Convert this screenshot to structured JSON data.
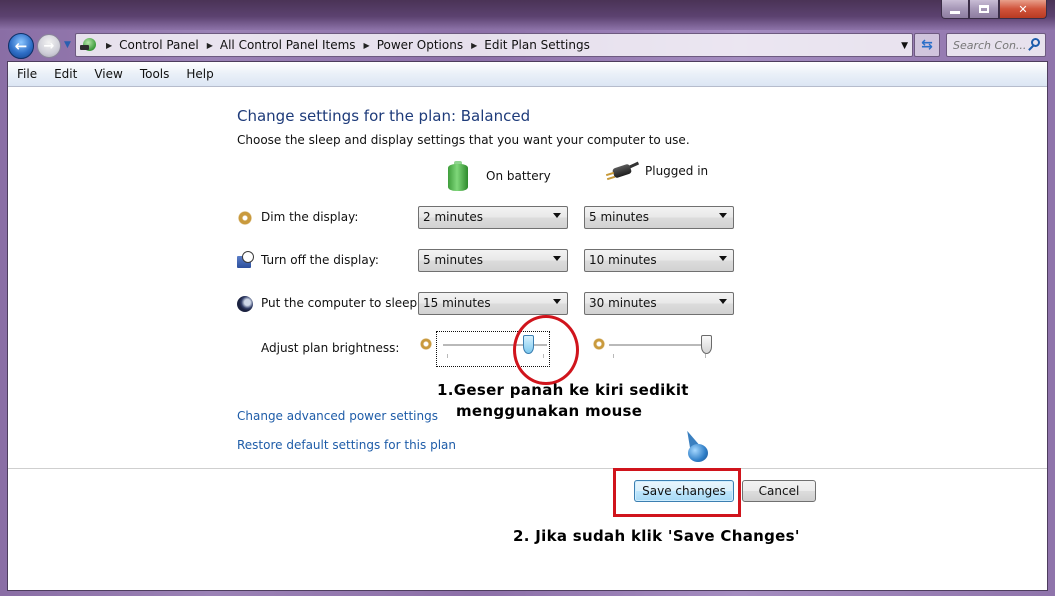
{
  "window": {
    "caption_buttons": [
      "minimize",
      "maximize",
      "close"
    ]
  },
  "nav": {
    "back_icon": "back-arrow-icon",
    "forward_icon": "forward-arrow-icon",
    "breadcrumb": [
      "Control Panel",
      "All Control Panel Items",
      "Power Options",
      "Edit Plan Settings"
    ],
    "search_placeholder": "Search Con...",
    "refresh_icon": "refresh-icon"
  },
  "menubar": {
    "items": [
      "File",
      "Edit",
      "View",
      "Tools",
      "Help"
    ]
  },
  "page": {
    "title": "Change settings for the plan: Balanced",
    "subtitle": "Choose the sleep and display settings that you want your computer to use.",
    "columns": {
      "battery": "On battery",
      "plugged": "Plugged in"
    },
    "settings": [
      {
        "label": "Dim the display:",
        "icon": "dim-display-icon",
        "battery": "2 minutes",
        "plugged": "5 minutes"
      },
      {
        "label": "Turn off the display:",
        "icon": "display-off-icon",
        "battery": "5 minutes",
        "plugged": "10 minutes"
      },
      {
        "label": "Put the computer to sleep:",
        "icon": "sleep-icon",
        "battery": "15 minutes",
        "plugged": "30 minutes"
      }
    ],
    "brightness": {
      "label": "Adjust plan brightness:",
      "battery_level_percent": 85,
      "plugged_level_percent": 100
    },
    "links": {
      "advanced": "Change advanced power settings",
      "restore": "Restore default settings for this plan"
    },
    "buttons": {
      "save": "Save changes",
      "cancel": "Cancel"
    }
  },
  "annotations": {
    "step1_number": "1.",
    "step1_line1": "Geser panah ke kiri sedikit",
    "step1_line2": "menggunakan mouse",
    "step2": "2. Jika sudah klik 'Save Changes'",
    "highlight_color": "#d0141c"
  }
}
